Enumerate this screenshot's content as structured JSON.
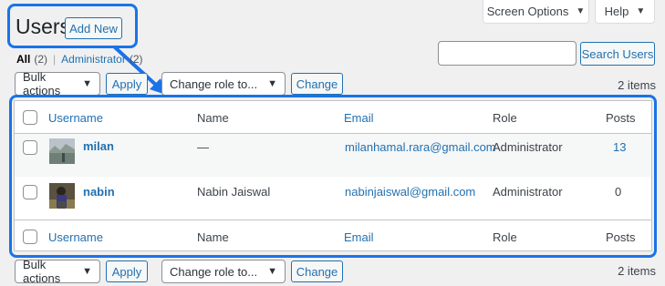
{
  "header": {
    "screen_options_label": "Screen Options",
    "help_label": "Help",
    "page_title": "Users",
    "add_new_label": "Add New"
  },
  "views": {
    "all_label": "All",
    "all_count": "(2)",
    "separator": "|",
    "admin_label": "Administrator",
    "admin_count": "(2)"
  },
  "search": {
    "placeholder": "",
    "button_label": "Search Users"
  },
  "tablenav_top": {
    "bulk_actions": "Bulk actions",
    "apply_label": "Apply",
    "change_role": "Change role to...",
    "change_label": "Change",
    "items_count": "2 items"
  },
  "tablenav_bottom": {
    "bulk_actions": "Bulk actions",
    "apply_label": "Apply",
    "change_role": "Change role to...",
    "change_label": "Change",
    "items_count": "2 items"
  },
  "table": {
    "columns": {
      "username": "Username",
      "name": "Name",
      "email": "Email",
      "role": "Role",
      "posts": "Posts"
    },
    "rows": [
      {
        "username": "milan",
        "name": "—",
        "email": "milanhamal.rara@gmail.com",
        "role": "Administrator",
        "posts": "13"
      },
      {
        "username": "nabin",
        "name": "Nabin Jaiswal",
        "email": "nabinjaiswal@gmail.com",
        "role": "Administrator",
        "posts": "0"
      }
    ]
  },
  "colors": {
    "highlight": "#1a73e8",
    "link": "#2271b1",
    "background": "#f0f0f1"
  },
  "icons": {
    "dropdown": "caret-down-icon",
    "arrow": "annotation-arrow-icon"
  }
}
